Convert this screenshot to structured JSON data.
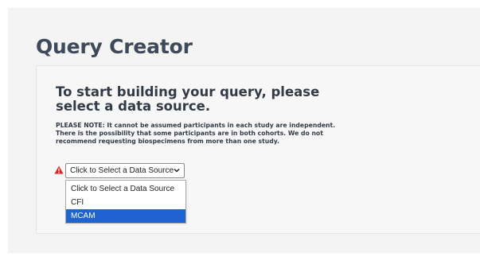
{
  "page": {
    "title": "Query Creator"
  },
  "card": {
    "heading": "To start building your query, please select a data source.",
    "note": "PLEASE NOTE: It cannot be assumed participants in each study are independent. There is the possibility that some participants are in both cohorts. We do not recommend requesting biospecimens from more than one study."
  },
  "data_source": {
    "selected_value": "Click to Select a Data Source",
    "options": [
      "Click to Select a Data Source",
      "CFI",
      "MCAM"
    ],
    "highlighted_option": "MCAM",
    "warning_icon": "warning-triangle-icon",
    "warning_color": "#e02020",
    "highlight_color": "#1f63d0"
  }
}
